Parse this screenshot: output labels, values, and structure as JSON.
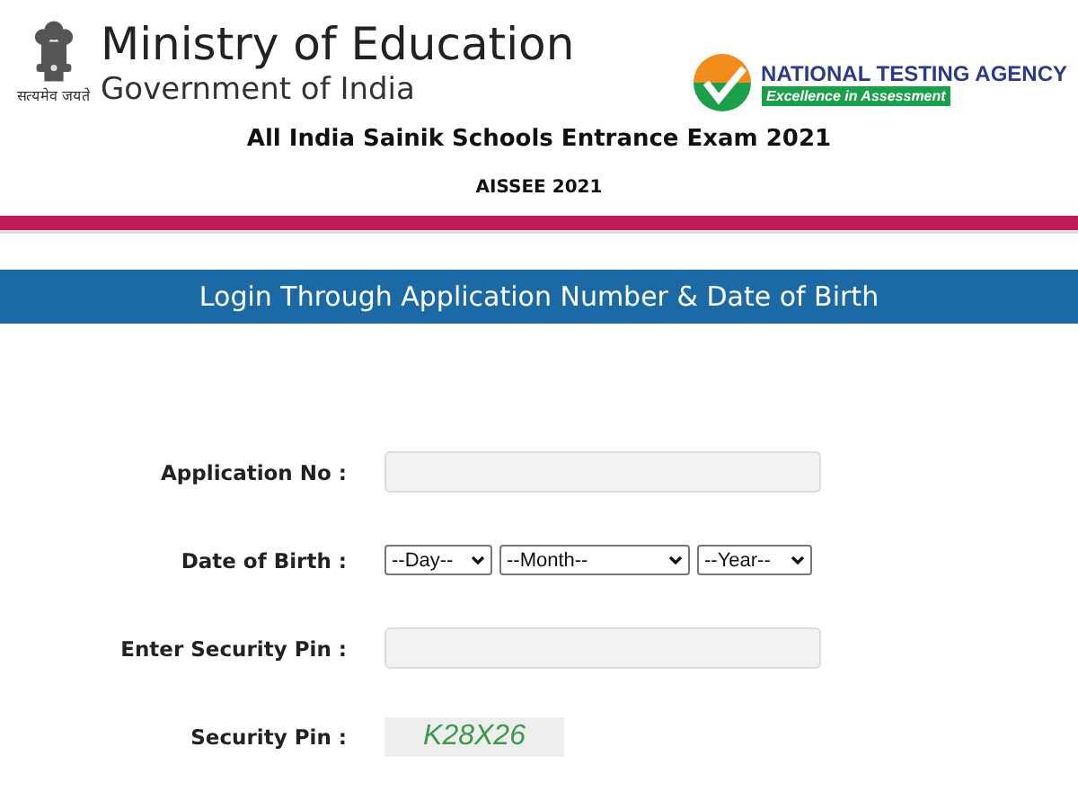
{
  "header": {
    "ministry": "Ministry of Education",
    "government": "Government of India",
    "motto": "सत्यमेव जयते",
    "agency": "NATIONAL TESTING AGENCY",
    "agency_tagline": "Excellence in Assessment",
    "exam_title": "All India Sainik Schools Entrance Exam 2021",
    "exam_code": "AISSEE 2021"
  },
  "banner": {
    "title": "Login Through Application Number & Date of Birth"
  },
  "form": [
    {
      "kind": "text",
      "label": "Application No :"
    },
    {
      "kind": "date",
      "label": "Date of Birth :",
      "selects": [
        {
          "value": "--Day--"
        },
        {
          "value": "--Month--"
        },
        {
          "value": "--Year--"
        }
      ]
    },
    {
      "kind": "text",
      "label": "Enter Security Pin :"
    },
    {
      "kind": "captcha",
      "label": "Security Pin :",
      "value": "K28X26"
    }
  ]
}
